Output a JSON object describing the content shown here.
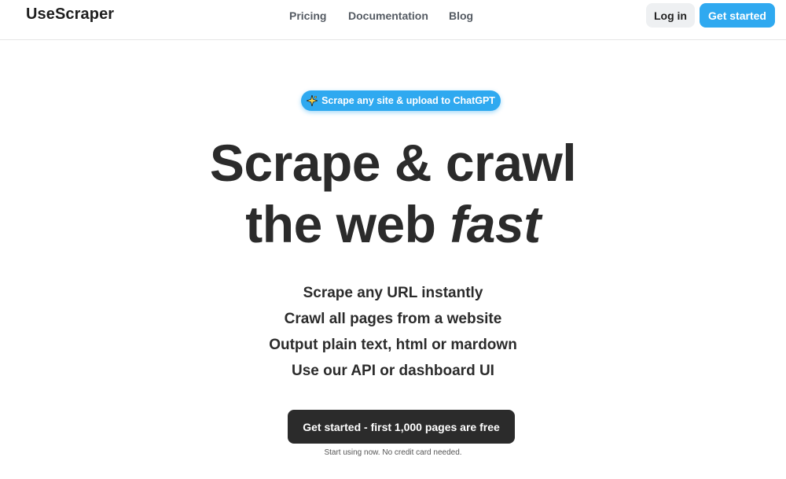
{
  "header": {
    "logo": "UseScraper",
    "nav": [
      "Pricing",
      "Documentation",
      "Blog"
    ],
    "login_label": "Log in",
    "get_started_label": "Get started"
  },
  "badge": {
    "icon": "sparkle-icon",
    "label": "Scrape any site & upload to ChatGPT"
  },
  "hero": {
    "line1": "Scrape & crawl",
    "line2_prefix": "the web ",
    "line2_emphasis": "fast"
  },
  "features": [
    "Scrape any URL instantly",
    "Crawl all pages from a website",
    "Output plain text, html or mardown",
    "Use our API or dashboard UI"
  ],
  "cta": {
    "label": "Get started - first 1,000 pages are free",
    "note": "Start using now. No credit card needed."
  },
  "colors": {
    "accent": "#2fa9f0",
    "dark_button": "#2b2b2b",
    "light_button": "#eef0f2"
  }
}
